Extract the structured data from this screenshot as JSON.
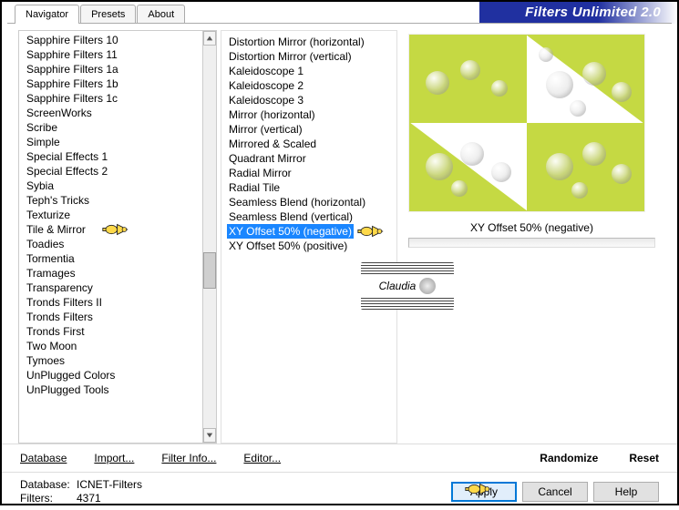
{
  "header": {
    "tabs": [
      "Navigator",
      "Presets",
      "About"
    ],
    "title": "Filters Unlimited 2.0"
  },
  "left_list": [
    "Sapphire Filters 10",
    "Sapphire Filters 11",
    "Sapphire Filters 1a",
    "Sapphire Filters 1b",
    "Sapphire Filters 1c",
    "ScreenWorks",
    "Scribe",
    "Simple",
    "Special Effects 1",
    "Special Effects 2",
    "Sybia",
    "Teph's Tricks",
    "Texturize",
    "Tile & Mirror",
    "Toadies",
    "Tormentia",
    "Tramages",
    "Transparency",
    "Tronds Filters II",
    "Tronds Filters",
    "Tronds First",
    "Two Moon",
    "Tymoes",
    "UnPlugged Colors",
    "UnPlugged Tools"
  ],
  "left_selected_index": 13,
  "mid_list": [
    "Distortion Mirror (horizontal)",
    "Distortion Mirror (vertical)",
    "Kaleidoscope 1",
    "Kaleidoscope 2",
    "Kaleidoscope 3",
    "Mirror (horizontal)",
    "Mirror (vertical)",
    "Mirrored & Scaled",
    "Quadrant Mirror",
    "Radial Mirror",
    "Radial Tile",
    "Seamless Blend (horizontal)",
    "Seamless Blend (vertical)",
    "XY Offset 50% (negative)",
    "XY Offset 50% (positive)"
  ],
  "mid_selected_index": 13,
  "preview": {
    "label": "XY Offset 50% (negative)"
  },
  "watermark": {
    "text": "Claudia"
  },
  "bottom_links": {
    "database": "Database",
    "import": "Import...",
    "filter_info": "Filter Info...",
    "editor": "Editor...",
    "randomize": "Randomize",
    "reset": "Reset"
  },
  "status": {
    "db_label": "Database:",
    "db_value": "ICNET-Filters",
    "filters_label": "Filters:",
    "filters_value": "4371"
  },
  "buttons": {
    "apply": "Apply",
    "cancel": "Cancel",
    "help": "Help"
  }
}
